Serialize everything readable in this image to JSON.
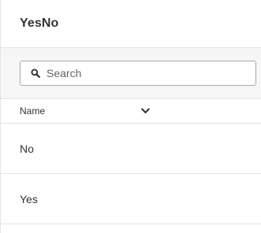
{
  "header": {
    "title": "YesNo"
  },
  "search": {
    "placeholder": "Search",
    "value": "",
    "icon": "search-icon"
  },
  "table": {
    "column": {
      "label": "Name",
      "sort_icon": "chevron-down-icon"
    },
    "rows": [
      {
        "label": "No"
      },
      {
        "label": "Yes"
      }
    ]
  }
}
